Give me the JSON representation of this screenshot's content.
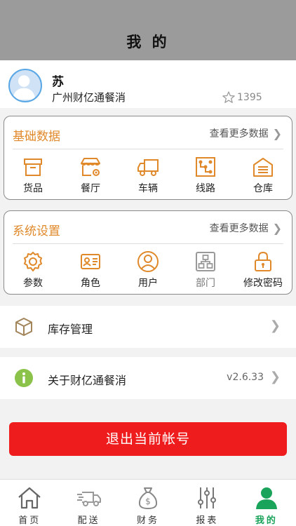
{
  "header": {
    "title": "我 的"
  },
  "profile": {
    "name": "苏",
    "company": "广州财亿通餐消",
    "points": "1395"
  },
  "basic_data": {
    "title": "基础数据",
    "more": "查看更多数据",
    "items": [
      {
        "label": "货品",
        "icon": "box-icon"
      },
      {
        "label": "餐厅",
        "icon": "restaurant-icon"
      },
      {
        "label": "车辆",
        "icon": "truck-icon"
      },
      {
        "label": "线路",
        "icon": "route-icon"
      },
      {
        "label": "仓库",
        "icon": "warehouse-icon"
      }
    ]
  },
  "system_settings": {
    "title": "系统设置",
    "more": "查看更多数据",
    "items": [
      {
        "label": "参数",
        "icon": "gear-icon"
      },
      {
        "label": "角色",
        "icon": "id-card-icon"
      },
      {
        "label": "用户",
        "icon": "user-icon"
      },
      {
        "label": "部门",
        "icon": "org-chart-icon"
      },
      {
        "label": "修改密码",
        "icon": "lock-icon"
      }
    ]
  },
  "inventory": {
    "label": "库存管理"
  },
  "about": {
    "label": "关于财亿通餐消",
    "version": "v2.6.33"
  },
  "logout": {
    "label": "退出当前帐号"
  },
  "tabbar": [
    {
      "label": "首页",
      "icon": "home-icon"
    },
    {
      "label": "配送",
      "icon": "delivery-truck-icon"
    },
    {
      "label": "财务",
      "icon": "money-bag-icon"
    },
    {
      "label": "报表",
      "icon": "sliders-icon"
    },
    {
      "label": "我的",
      "icon": "person-icon",
      "active": true
    }
  ],
  "colors": {
    "accent": "#e0892a",
    "active_tab": "#1aa35a",
    "logout": "#ee1c1c",
    "header": "#9b9b9b"
  }
}
